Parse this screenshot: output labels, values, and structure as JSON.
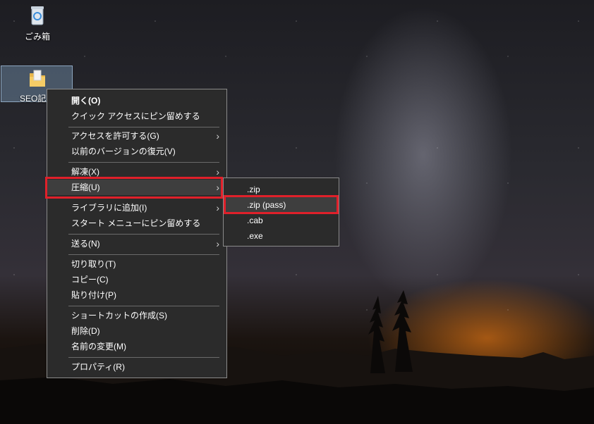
{
  "desktop": {
    "icons": [
      {
        "label": "ごみ箱",
        "icon": "recycle-bin-icon"
      },
      {
        "label": "SEO記",
        "icon": "folder-icon"
      }
    ]
  },
  "context_menu": {
    "items": [
      {
        "label": "開く(O)",
        "bold": true
      },
      {
        "label": "クイック アクセスにピン留めする"
      },
      {
        "label": "アクセスを許可する(G)",
        "submenu": true
      },
      {
        "label": "以前のバージョンの復元(V)"
      },
      {
        "label": "解凍(X)",
        "submenu": true
      },
      {
        "label": "圧縮(U)",
        "submenu": true,
        "highlighted": true
      },
      {
        "label": "ライブラリに追加(I)",
        "submenu": true
      },
      {
        "label": "スタート メニューにピン留めする"
      },
      {
        "label": "送る(N)",
        "submenu": true
      },
      {
        "label": "切り取り(T)"
      },
      {
        "label": "コピー(C)"
      },
      {
        "label": "貼り付け(P)"
      },
      {
        "label": "ショートカットの作成(S)"
      },
      {
        "label": "削除(D)"
      },
      {
        "label": "名前の変更(M)"
      },
      {
        "label": "プロパティ(R)"
      }
    ],
    "arrow_glyph": "›"
  },
  "submenu": {
    "items": [
      {
        "label": ".zip"
      },
      {
        "label": ".zip (pass)",
        "highlighted": true
      },
      {
        "label": ".cab"
      },
      {
        "label": ".exe"
      }
    ]
  },
  "colors": {
    "menu_bg": "#2b2b2b",
    "highlight_box": "#e0202a",
    "hover": "#3e3e3e"
  }
}
